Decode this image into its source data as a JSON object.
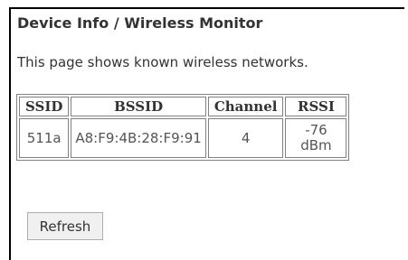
{
  "page": {
    "title": "Device Info / Wireless Monitor",
    "description": "This page shows known wireless networks."
  },
  "table": {
    "columns": [
      "SSID",
      "BSSID",
      "Channel",
      "RSSI"
    ],
    "rows": [
      {
        "ssid": "511a",
        "bssid": "A8:F9:4B:28:F9:91",
        "channel": "4",
        "rssi_value": "-76",
        "rssi_unit": "dBm"
      }
    ]
  },
  "actions": {
    "refresh_label": "Refresh"
  }
}
